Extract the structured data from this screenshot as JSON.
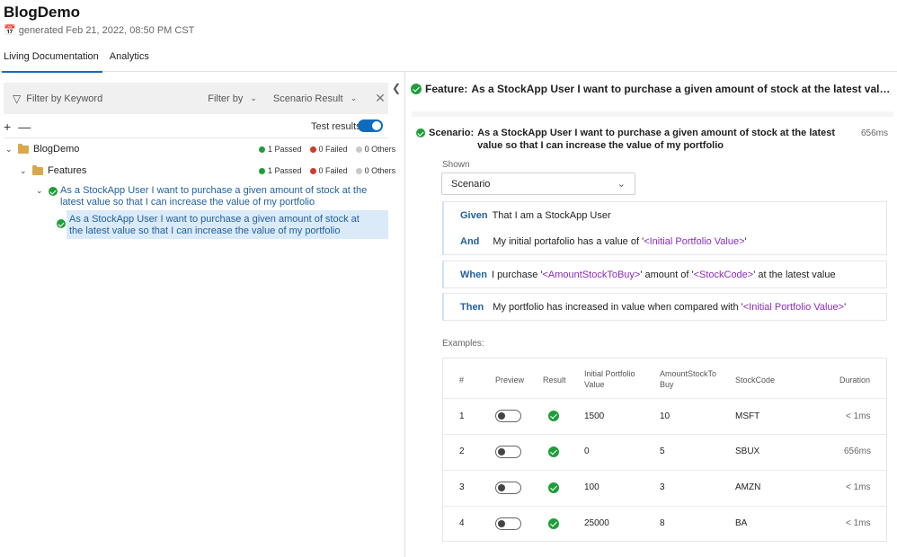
{
  "app": {
    "title": "BlogDemo",
    "generated": "generated Feb 21, 2022, 08:50 PM CST"
  },
  "tabs": [
    "Living Documentation",
    "Analytics"
  ],
  "filter": {
    "keyword_placeholder": "Filter by Keyword",
    "filter_by": "Filter by",
    "scenario_result": "Scenario Result"
  },
  "toolbar": {
    "expand": "+",
    "collapse": "—",
    "test_results_label": "Test results"
  },
  "tree": {
    "root": {
      "label": "BlogDemo",
      "passed": "1 Passed",
      "failed": "0 Failed",
      "others": "0 Others"
    },
    "features": {
      "label": "Features",
      "passed": "1 Passed",
      "failed": "0 Failed",
      "others": "0 Others"
    },
    "feature_item": "As a StockApp User I want to purchase a given amount of stock at the latest value so that I can increase the value of my portfolio",
    "scenario_item": "As a StockApp User I want to purchase a given amount of stock at the latest value so that I can increase the value of my portfolio"
  },
  "detail": {
    "feature_keyword": "Feature:",
    "feature_title": "As a StockApp User I want to purchase a given amount of stock at the latest value so t...",
    "scenario_keyword": "Scenario:",
    "scenario_title": "As a StockApp User I want to purchase a given amount of stock at the latest value so that I can increase the value of my portfolio",
    "scenario_duration": "656ms",
    "shown_label": "Shown",
    "shown_value": "Scenario",
    "steps": {
      "given_kw": "Given",
      "given_text": "That I am a StockApp User",
      "and_kw": "And",
      "and_pre": "My initial portafolio has a value of '",
      "and_param": "<Initial Portfolio Value>",
      "and_post": "'",
      "when_kw": "When",
      "when_pre": "I purchase '",
      "when_param1": "<AmountStockToBuy>",
      "when_mid": "' amount of '",
      "when_param2": "<StockCode>",
      "when_post": "' at the latest value",
      "then_kw": "Then",
      "then_pre": "My portfolio has increased in value when compared with '",
      "then_param": "<Initial Portfolio Value>",
      "then_post": "'"
    },
    "examples_label": "Examples:",
    "table": {
      "headers": [
        "#",
        "Preview",
        "Result",
        "Initial Portfolio Value",
        "AmountStockTo Buy",
        "StockCode",
        "Duration"
      ],
      "rows": [
        {
          "n": "1",
          "initial": "1500",
          "amount": "10",
          "code": "MSFT",
          "duration": "< 1ms"
        },
        {
          "n": "2",
          "initial": "0",
          "amount": "5",
          "code": "SBUX",
          "duration": "656ms"
        },
        {
          "n": "3",
          "initial": "100",
          "amount": "3",
          "code": "AMZN",
          "duration": "< 1ms"
        },
        {
          "n": "4",
          "initial": "25000",
          "amount": "8",
          "code": "BA",
          "duration": "< 1ms"
        }
      ]
    }
  }
}
